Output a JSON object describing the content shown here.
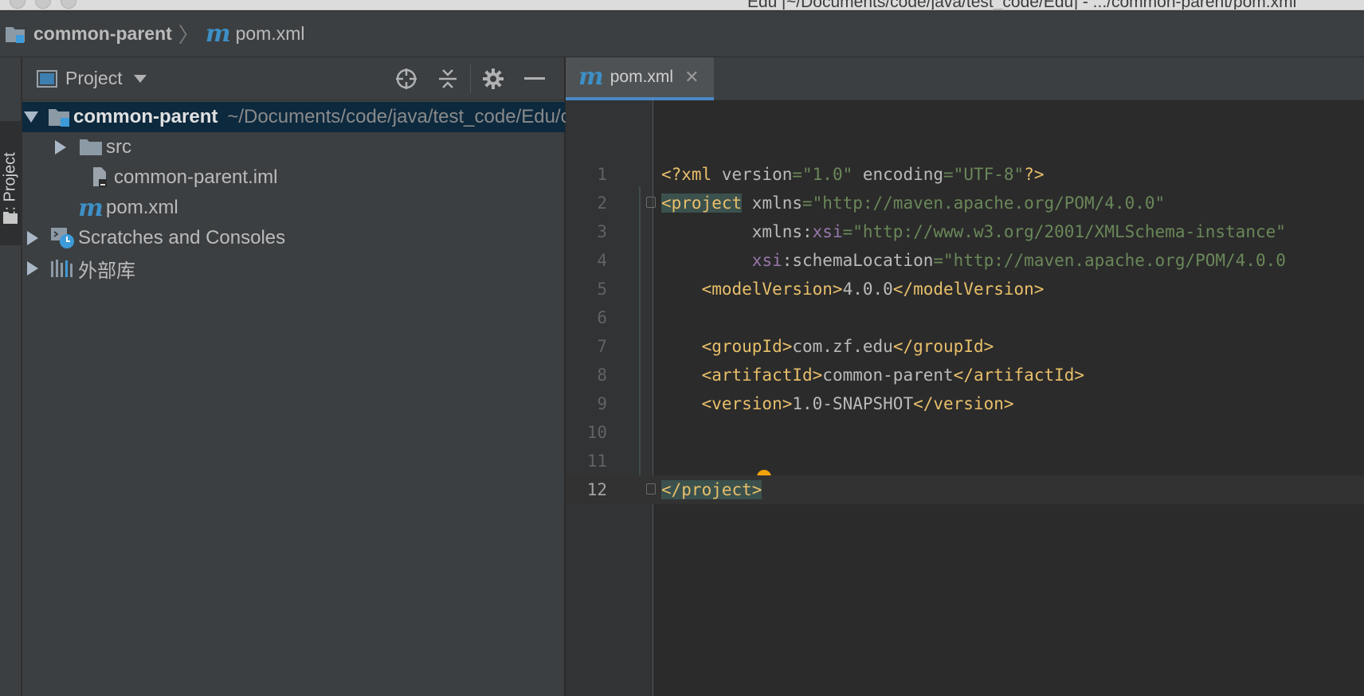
{
  "window": {
    "title": "Edu [~/Documents/code/java/test_code/Edu] - .../common-parent/pom.xml"
  },
  "navbar": {
    "project": "common-parent",
    "file": "pom.xml"
  },
  "stripe": {
    "label": "1: Project"
  },
  "project_panel": {
    "title": "Project",
    "tree": [
      {
        "label": "common-parent",
        "path": "~/Documents/code/java/test_code/Edu/common-parent",
        "icon": "module-folder-icon",
        "expanded": true,
        "selected": true,
        "level": 0
      },
      {
        "label": "src",
        "icon": "folder-icon",
        "expanded": false,
        "level": 1
      },
      {
        "label": "common-parent.iml",
        "icon": "iml-file-icon",
        "level": 1
      },
      {
        "label": "pom.xml",
        "icon": "maven-icon",
        "level": 1
      },
      {
        "label": "Scratches and Consoles",
        "icon": "scratches-icon",
        "expanded": false,
        "level": 0
      },
      {
        "label": "外部库",
        "icon": "libraries-icon",
        "expanded": false,
        "level": 0
      }
    ]
  },
  "editor": {
    "tab": {
      "label": "pom.xml"
    },
    "current_line": 12,
    "lines": [
      {
        "n": "1"
      },
      {
        "n": "2"
      },
      {
        "n": "3"
      },
      {
        "n": "4"
      },
      {
        "n": "5"
      },
      {
        "n": "6"
      },
      {
        "n": "7"
      },
      {
        "n": "8"
      },
      {
        "n": "9"
      },
      {
        "n": "10"
      },
      {
        "n": "11"
      },
      {
        "n": "12"
      }
    ],
    "code": {
      "l1_decl": "<?xml",
      "l1_a1": " version",
      "l1_v1": "=\"1.0\"",
      "l1_a2": " encoding",
      "l1_v2": "=\"UTF-8\"",
      "l1_end": "?>",
      "l2_open": "<project",
      "l2_attr": " xmlns",
      "l2_val": "=\"http://maven.apache.org/POM/4.0.0\"",
      "l3_pre": "         xmlns:",
      "l3_ns": "xsi",
      "l3_val": "=\"http://www.w3.org/2001/XMLSchema-instance\"",
      "l4_pre": "         ",
      "l4_ns": "xsi",
      "l4_attr": ":schemaLocation",
      "l4_val": "=\"http://maven.apache.org/POM/4.0.0",
      "l5_open": "    <modelVersion>",
      "l5_text": "4.0.0",
      "l5_close": "</modelVersion>",
      "l7_open": "    <groupId>",
      "l7_text": "com.zf.edu",
      "l7_close": "</groupId>",
      "l8_open": "    <artifactId>",
      "l8_text": "common-parent",
      "l8_close": "</artifactId>",
      "l9_open": "    <version>",
      "l9_text": "1.0-SNAPSHOT",
      "l9_close": "</version>",
      "l12_close": "</project",
      "l12_gt": ">"
    }
  },
  "colors": {
    "accent": "#4a88c7",
    "tag": "#e8bf6a",
    "string": "#6a8759",
    "namespace": "#9876aa",
    "selection": "#0d293e",
    "maven": "#3d8fc6"
  }
}
